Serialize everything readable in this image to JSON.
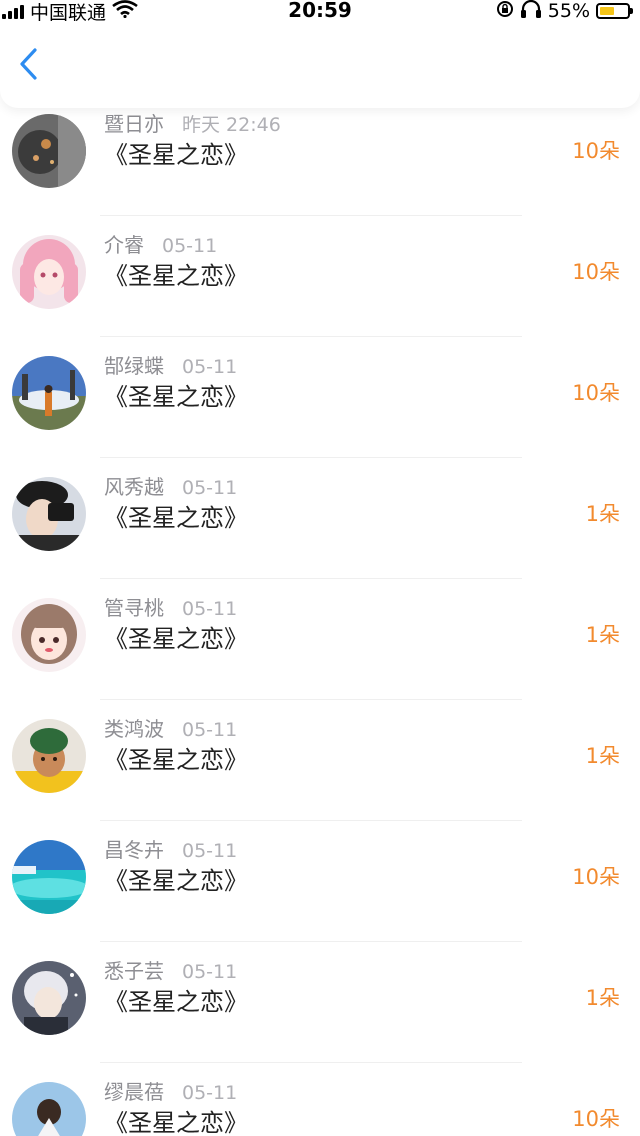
{
  "status_bar": {
    "carrier": "中国联通",
    "time": "20:59",
    "battery_percent": "55%",
    "battery_level": 0.55,
    "icons": [
      "signal-icon",
      "wifi-icon",
      "rotation-lock-icon",
      "headphones-icon",
      "battery-icon"
    ]
  },
  "nav": {
    "back_icon": "chevron-left-icon",
    "accent": "#2d8cf0"
  },
  "colors": {
    "amount": "#f28a2e",
    "name": "#8e8e93",
    "title": "#222222"
  },
  "gifts": [
    {
      "user": "暨日亦",
      "time": "昨天 22:46",
      "title": "《圣星之恋》",
      "amount": "10朵"
    },
    {
      "user": "介睿",
      "time": "05-11",
      "title": "《圣星之恋》",
      "amount": "10朵"
    },
    {
      "user": "郜绿蝶",
      "time": "05-11",
      "title": "《圣星之恋》",
      "amount": "10朵"
    },
    {
      "user": "风秀越",
      "time": "05-11",
      "title": "《圣星之恋》",
      "amount": "1朵"
    },
    {
      "user": "管寻桃",
      "time": "05-11",
      "title": "《圣星之恋》",
      "amount": "1朵"
    },
    {
      "user": "类鸿波",
      "time": "05-11",
      "title": "《圣星之恋》",
      "amount": "1朵"
    },
    {
      "user": "昌冬卉",
      "time": "05-11",
      "title": "《圣星之恋》",
      "amount": "10朵"
    },
    {
      "user": "悉子芸",
      "time": "05-11",
      "title": "《圣星之恋》",
      "amount": "1朵"
    },
    {
      "user": "缪晨蓓",
      "time": "05-11",
      "title": "《圣星之恋》",
      "amount": "10朵"
    }
  ]
}
